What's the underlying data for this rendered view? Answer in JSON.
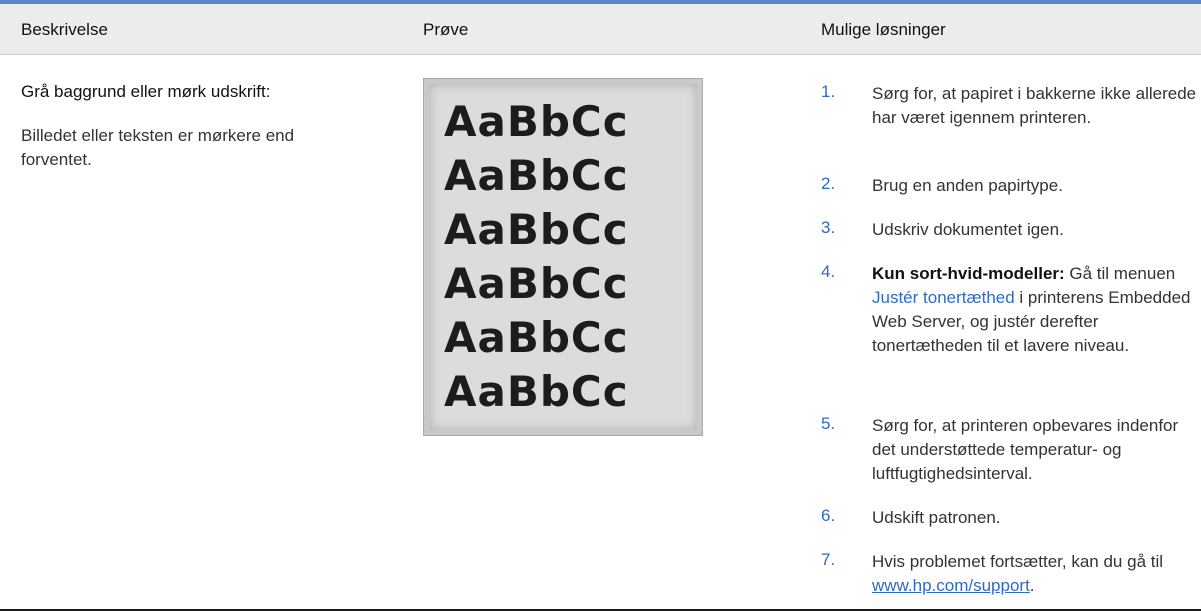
{
  "header": {
    "col1": "Beskrivelse",
    "col2": "Prøve",
    "col3": "Mulige løsninger"
  },
  "description": {
    "title": "Grå baggrund eller mørk udskrift:",
    "body": "Billedet eller teksten er mørkere end forventet."
  },
  "sample": {
    "lines": [
      "AaBbCc",
      "AaBbCc",
      "AaBbCc",
      "AaBbCc",
      "AaBbCc",
      "AaBbCc"
    ]
  },
  "solutions": [
    {
      "num": "1.",
      "text": "Sørg for, at papiret i bakkerne ikke allerede har været igennem printeren."
    },
    {
      "num": "2.",
      "text": "Brug en anden papirtype."
    },
    {
      "num": "3.",
      "text": "Udskriv dokumentet igen."
    },
    {
      "num": "4.",
      "bold": "Kun sort-hvid-modeller:",
      "pre": " Gå til menuen ",
      "link": "Justér tonertæthed",
      "post": " i printerens Embedded Web Server, og justér derefter tonertætheden til et lavere niveau."
    },
    {
      "num": "5.",
      "text": "Sørg for, at printeren opbevares indenfor det understøttede temperatur- og luftfugtighedsinterval."
    },
    {
      "num": "6.",
      "text": "Udskift patronen."
    },
    {
      "num": "7.",
      "pre": "Hvis problemet fortsætter, kan du gå til ",
      "link": "www.hp.com/support",
      "post": "."
    }
  ],
  "colors": {
    "accent": "#2f6bbf",
    "top_rule": "#5a86c8",
    "header_bg": "#ececec"
  }
}
